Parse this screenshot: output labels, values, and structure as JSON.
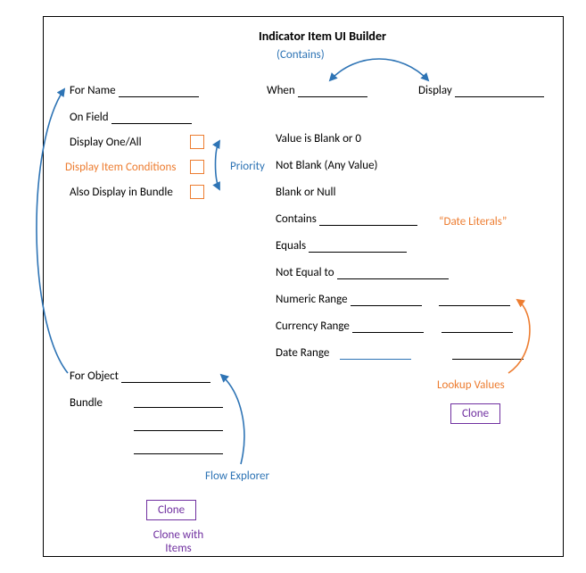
{
  "title": "Indicator Item UI Builder",
  "contains_hint": "(Contains)",
  "left": {
    "for_name": "For Name",
    "on_field": "On Field",
    "display_one_all": "Display One/All",
    "display_item_conditions": "Display Item Conditions",
    "also_display_in_bundle": "Also Display in Bundle",
    "for_object": "For Object",
    "bundle": "Bundle"
  },
  "mid": {
    "when": "When",
    "display": "Display",
    "conditions": {
      "blank0": "Value is Blank or 0",
      "not_blank": "Not Blank (Any Value)",
      "blank_null": "Blank or Null",
      "contains": "Contains",
      "equals": "Equals",
      "not_equal": "Not Equal to",
      "numeric_range": "Numeric Range",
      "currency_range": "Currency Range",
      "date_range": "Date Range"
    }
  },
  "annotations": {
    "priority": "Priority",
    "date_literals": "“Date Literals”",
    "lookup_values": "Lookup Values",
    "flow_explorer": "Flow Explorer"
  },
  "buttons": {
    "clone": "Clone",
    "clone_with_items": "Clone with Items"
  },
  "colors": {
    "blue": "#2e74b5",
    "orange": "#ed7d31",
    "purple": "#7030a0"
  }
}
